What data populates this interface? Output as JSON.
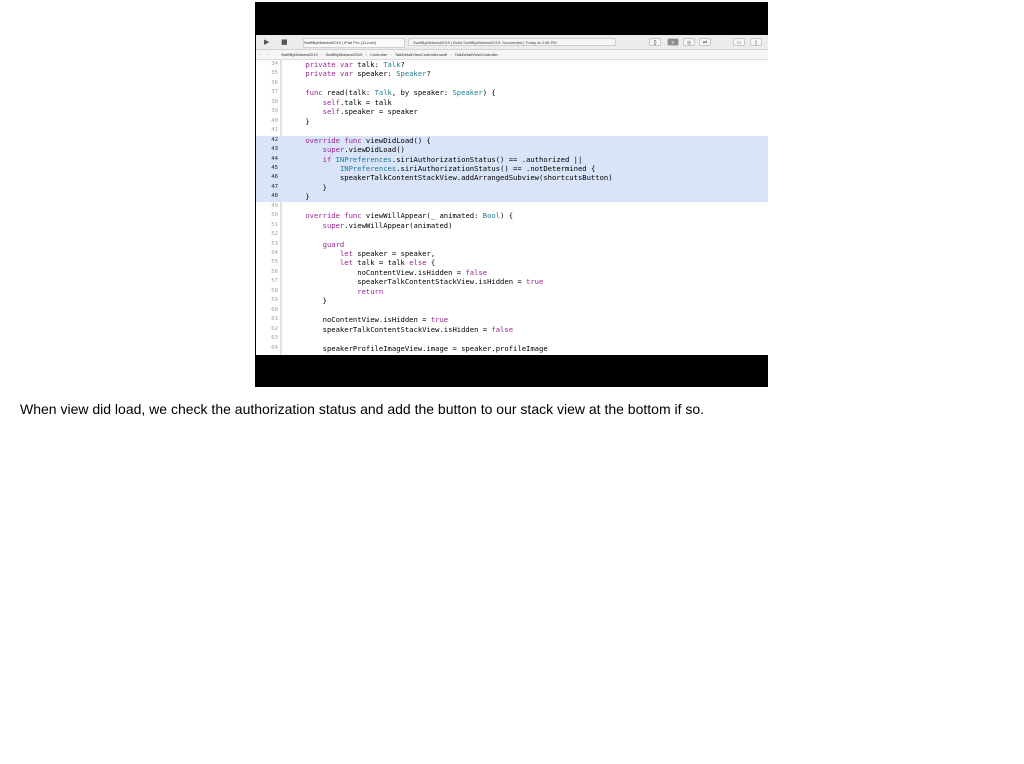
{
  "toolbar": {
    "scheme_label": "SwiftByMidwest2019 | iPad Pro (11-inch)",
    "activity_text": "SwiftByMidwest2019 | Build SwiftByMidwest2019: Succeeded | Today at 2:58 PM"
  },
  "jumpbar": [
    "SwiftByMidwest2019",
    "SwiftByMidwest2019",
    "Controller",
    "TalkDetailViewController.swift",
    "TalkDetailViewController"
  ],
  "code": {
    "lines": [
      {
        "n": "34",
        "t": "    private var talk: Talk?",
        "hl": false
      },
      {
        "n": "35",
        "t": "    private var speaker: Speaker?",
        "hl": false
      },
      {
        "n": "36",
        "t": "",
        "hl": false
      },
      {
        "n": "37",
        "t": "    func read(talk: Talk, by speaker: Speaker) {",
        "hl": false
      },
      {
        "n": "38",
        "t": "        self.talk = talk",
        "hl": false
      },
      {
        "n": "39",
        "t": "        self.speaker = speaker",
        "hl": false
      },
      {
        "n": "40",
        "t": "    }",
        "hl": false
      },
      {
        "n": "41",
        "t": "",
        "hl": false
      },
      {
        "n": "42",
        "t": "    override func viewDidLoad() {",
        "hl": true
      },
      {
        "n": "43",
        "t": "        super.viewDidLoad()",
        "hl": true
      },
      {
        "n": "44",
        "t": "        if INPreferences.siriAuthorizationStatus() == .authorized ||",
        "hl": true
      },
      {
        "n": "45",
        "t": "            INPreferences.siriAuthorizationStatus() == .notDetermined {",
        "hl": true
      },
      {
        "n": "46",
        "t": "            speakerTalkContentStackView.addArrangedSubview(shortcutsButton)",
        "hl": true
      },
      {
        "n": "47",
        "t": "        }",
        "hl": true
      },
      {
        "n": "48",
        "t": "    }",
        "hl": true
      },
      {
        "n": "49",
        "t": "",
        "hl": false
      },
      {
        "n": "50",
        "t": "    override func viewWillAppear(_ animated: Bool) {",
        "hl": false
      },
      {
        "n": "51",
        "t": "        super.viewWillAppear(animated)",
        "hl": false
      },
      {
        "n": "52",
        "t": "",
        "hl": false
      },
      {
        "n": "53",
        "t": "        guard",
        "hl": false
      },
      {
        "n": "54",
        "t": "            let speaker = speaker,",
        "hl": false
      },
      {
        "n": "55",
        "t": "            let talk = talk else {",
        "hl": false
      },
      {
        "n": "56",
        "t": "                noContentView.isHidden = false",
        "hl": false
      },
      {
        "n": "57",
        "t": "                speakerTalkContentStackView.isHidden = true",
        "hl": false
      },
      {
        "n": "58",
        "t": "                return",
        "hl": false
      },
      {
        "n": "59",
        "t": "        }",
        "hl": false
      },
      {
        "n": "60",
        "t": "",
        "hl": false
      },
      {
        "n": "61",
        "t": "        noContentView.isHidden = true",
        "hl": false
      },
      {
        "n": "62",
        "t": "        speakerTalkContentStackView.isHidden = false",
        "hl": false
      },
      {
        "n": "63",
        "t": "",
        "hl": false
      },
      {
        "n": "64",
        "t": "        speakerProfileImageView.image = speaker.profileImage",
        "hl": false
      }
    ]
  },
  "caption": "When view did load, we check the authorization status and add the button to our stack view at the bottom if so."
}
